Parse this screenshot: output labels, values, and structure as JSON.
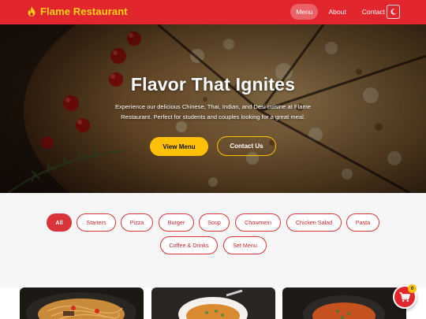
{
  "header": {
    "brand_name": "Flame Restaurant",
    "brand_icon": "flame-icon",
    "nav": [
      {
        "label": "Menu",
        "active": true
      },
      {
        "label": "About",
        "active": false
      },
      {
        "label": "Contact",
        "active": false
      }
    ],
    "theme_toggle_icon": "moon-icon"
  },
  "hero": {
    "title": "Flavor That Ignites",
    "subtitle": "Experience our delicious Chinese, Thai, Indian, and Desi cuisine at Flame Restaurant. Perfect for students and couples looking for a great meal.",
    "primary_button": "View Menu",
    "secondary_button": "Contact Us"
  },
  "filters": [
    {
      "label": "All",
      "active": true
    },
    {
      "label": "Starters",
      "active": false
    },
    {
      "label": "Pizza",
      "active": false
    },
    {
      "label": "Burger",
      "active": false
    },
    {
      "label": "Soup",
      "active": false
    },
    {
      "label": "Chowmein",
      "active": false
    },
    {
      "label": "Chicken Salad",
      "active": false
    },
    {
      "label": "Pasta",
      "active": false
    },
    {
      "label": "Coffee & Drinks",
      "active": false
    },
    {
      "label": "Set Menu",
      "active": false
    }
  ],
  "cart": {
    "count": "0",
    "icon": "cart-icon"
  },
  "colors": {
    "brand_red": "#e1262d",
    "accent_yellow": "#ffc107"
  }
}
